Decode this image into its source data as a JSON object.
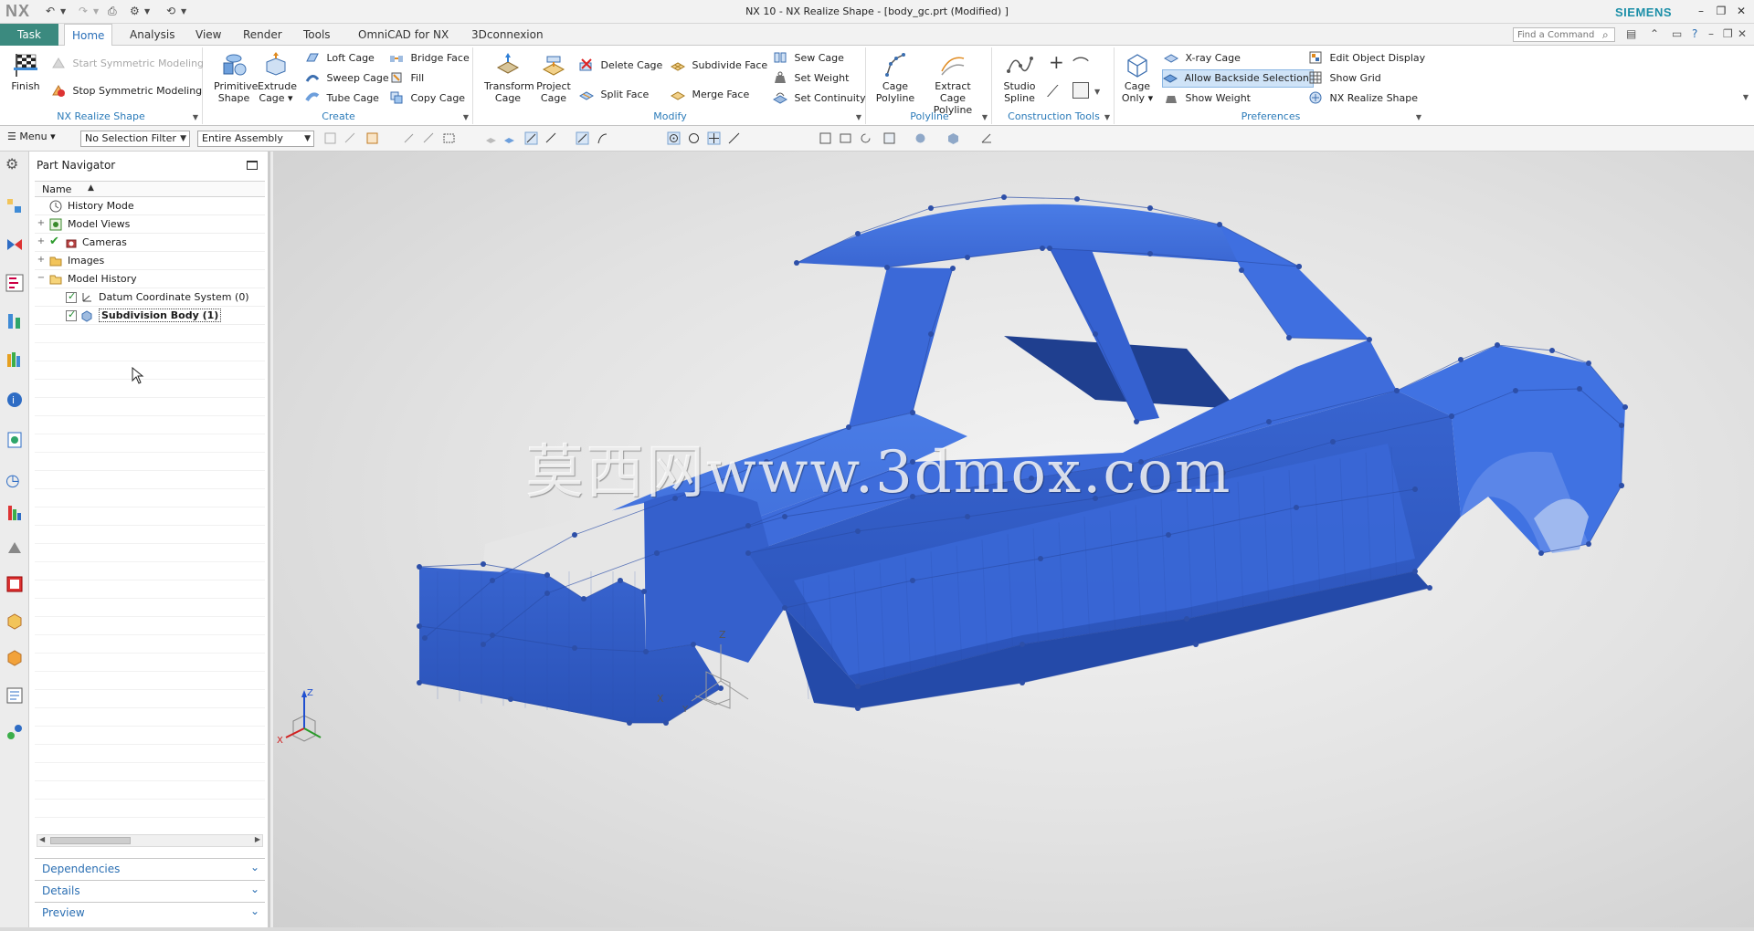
{
  "titlebar": {
    "logo": "NX",
    "title": "NX 10 - NX Realize Shape - [body_gc.prt (Modified) ]",
    "brand": "SIEMENS"
  },
  "tabs": {
    "task": "Task",
    "items": [
      "Home",
      "Analysis",
      "View",
      "Render",
      "Tools",
      "OmniCAD for NX",
      "3Dconnexion"
    ],
    "active": "Home"
  },
  "search": {
    "placeholder": "Find a Command"
  },
  "ribbon": {
    "groups": {
      "realize": {
        "label": "NX Realize Shape",
        "finish": "Finish",
        "start_sym": "Start Symmetric Modeling",
        "stop_sym": "Stop Symmetric Modeling"
      },
      "create": {
        "label": "Create",
        "primitive": [
          "Primitive",
          "Shape"
        ],
        "extrude": [
          "Extrude",
          "Cage"
        ],
        "loft": "Loft Cage",
        "sweep": "Sweep Cage",
        "tube": "Tube Cage",
        "bridge": "Bridge Face",
        "fill": "Fill",
        "copy": "Copy Cage"
      },
      "modify": {
        "label": "Modify",
        "transform": [
          "Transform",
          "Cage"
        ],
        "project": [
          "Project",
          "Cage"
        ],
        "delete": "Delete Cage",
        "split": "Split Face",
        "subdivide": "Subdivide Face",
        "merge": "Merge Face",
        "sew": "Sew Cage",
        "weight": "Set Weight",
        "continuity": "Set Continuity"
      },
      "polyline": {
        "label": "Polyline",
        "cage_poly": [
          "Cage",
          "Polyline"
        ],
        "extract_poly": [
          "Extract Cage",
          "Polyline"
        ]
      },
      "construction": {
        "label": "Construction Tools",
        "studio": [
          "Studio",
          "Spline"
        ]
      },
      "prefs": {
        "label": "Preferences",
        "cage_only": [
          "Cage",
          "Only"
        ],
        "xray": "X-ray Cage",
        "backside": "Allow Backside Selection",
        "show_weight": "Show Weight",
        "edit_display": "Edit Object Display",
        "show_grid": "Show Grid",
        "realize_shape": "NX Realize Shape"
      }
    }
  },
  "toolbar": {
    "menu": "Menu",
    "selection_filter": "No Selection Filter",
    "assembly_scope": "Entire Assembly"
  },
  "navigator": {
    "title": "Part Navigator",
    "column": "Name",
    "rows": [
      {
        "label": "History Mode"
      },
      {
        "label": "Model Views"
      },
      {
        "label": "Cameras"
      },
      {
        "label": "Images"
      },
      {
        "label": "Model History"
      },
      {
        "label": "Datum Coordinate System (0)"
      },
      {
        "label": "Subdivision Body (1)"
      }
    ],
    "panels": [
      "Dependencies",
      "Details",
      "Preview"
    ]
  },
  "graphics": {
    "watermark": "莫西网www.3dmox.com",
    "model_color": "#3f6fe0",
    "triad_labels": {
      "x": "X",
      "y": "Y",
      "z": "Z"
    }
  }
}
